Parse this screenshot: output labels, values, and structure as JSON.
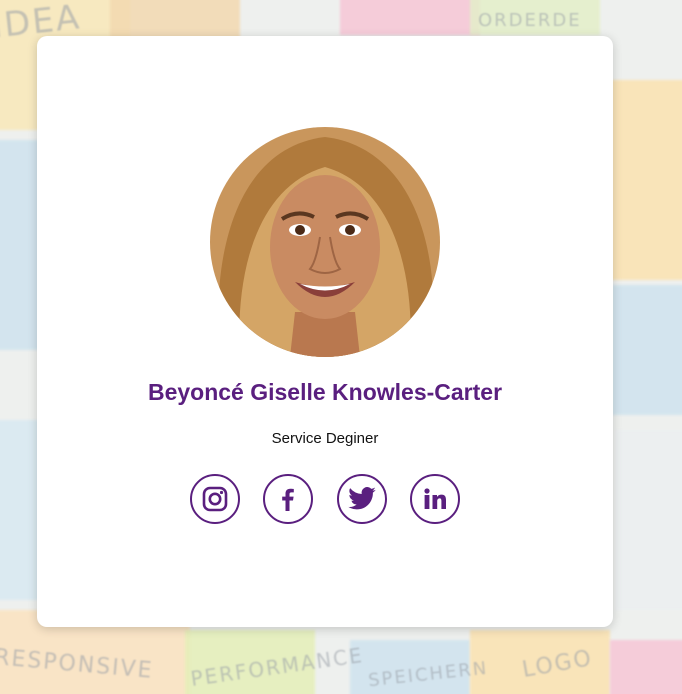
{
  "profile": {
    "name": "Beyoncé Giselle Knowles-Carter",
    "role": "Service Deginer"
  },
  "socials": [
    {
      "icon": "instagram-icon"
    },
    {
      "icon": "facebook-icon"
    },
    {
      "icon": "twitter-icon"
    },
    {
      "icon": "linkedin-icon"
    }
  ],
  "background_words": [
    "IDEA",
    "ORDERDE",
    "RESPONSIVE",
    "PERFORMANCE",
    "SPEICHERN",
    "LOGO"
  ],
  "colors": {
    "accent": "#5a1f7f",
    "card": "#ffffff"
  }
}
